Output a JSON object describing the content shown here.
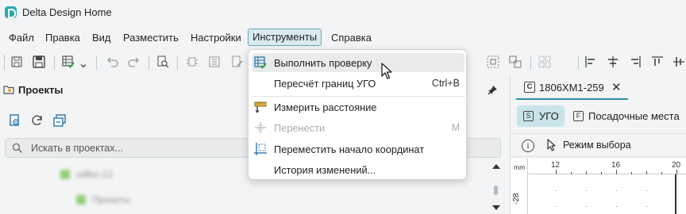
{
  "app": {
    "title": "Delta Design Home"
  },
  "menu": [
    "Файл",
    "Правка",
    "Вид",
    "Разместить",
    "Настройки",
    "Инструменты",
    "Справка"
  ],
  "projects_panel": {
    "title": "Проекты",
    "search_placeholder": "Искать в проектах...",
    "tree": [
      "sdfkn-12",
      "Проекты"
    ]
  },
  "document": {
    "tab_badge": "C",
    "tab_label": "1806ХМ1-259",
    "close": "✕",
    "view_tabs": [
      {
        "badge": "S",
        "label": "УГО"
      },
      {
        "badge": "F",
        "label": "Посадочные места"
      }
    ],
    "mode_label": "Режим выбора",
    "ruler_unit": "mm",
    "ruler_numbers": [
      "12",
      "16",
      "20"
    ],
    "ruler_vertical": "-28"
  },
  "tools_menu": {
    "items": [
      {
        "label": "Выполнить проверку",
        "shortcut": "",
        "disabled": false,
        "icon": "check-table-icon"
      },
      {
        "label": "Пересчёт границ УГО",
        "shortcut": "Ctrl+B",
        "disabled": false,
        "icon": ""
      },
      {
        "label": "Измерить расстояние",
        "shortcut": "",
        "disabled": false,
        "icon": "ruler-icon"
      },
      {
        "label": "Перенести",
        "shortcut": "M",
        "disabled": true,
        "icon": "move-icon"
      },
      {
        "label": "Переместить начало координат",
        "shortcut": "",
        "disabled": false,
        "icon": "origin-icon"
      },
      {
        "label": "История изменений...",
        "shortcut": "",
        "disabled": false,
        "icon": ""
      }
    ]
  },
  "colors": {
    "accent": "#2aa9b3",
    "active_menu_bg": "#d8eaee",
    "tab_active_bg": "#c9e4e8"
  }
}
